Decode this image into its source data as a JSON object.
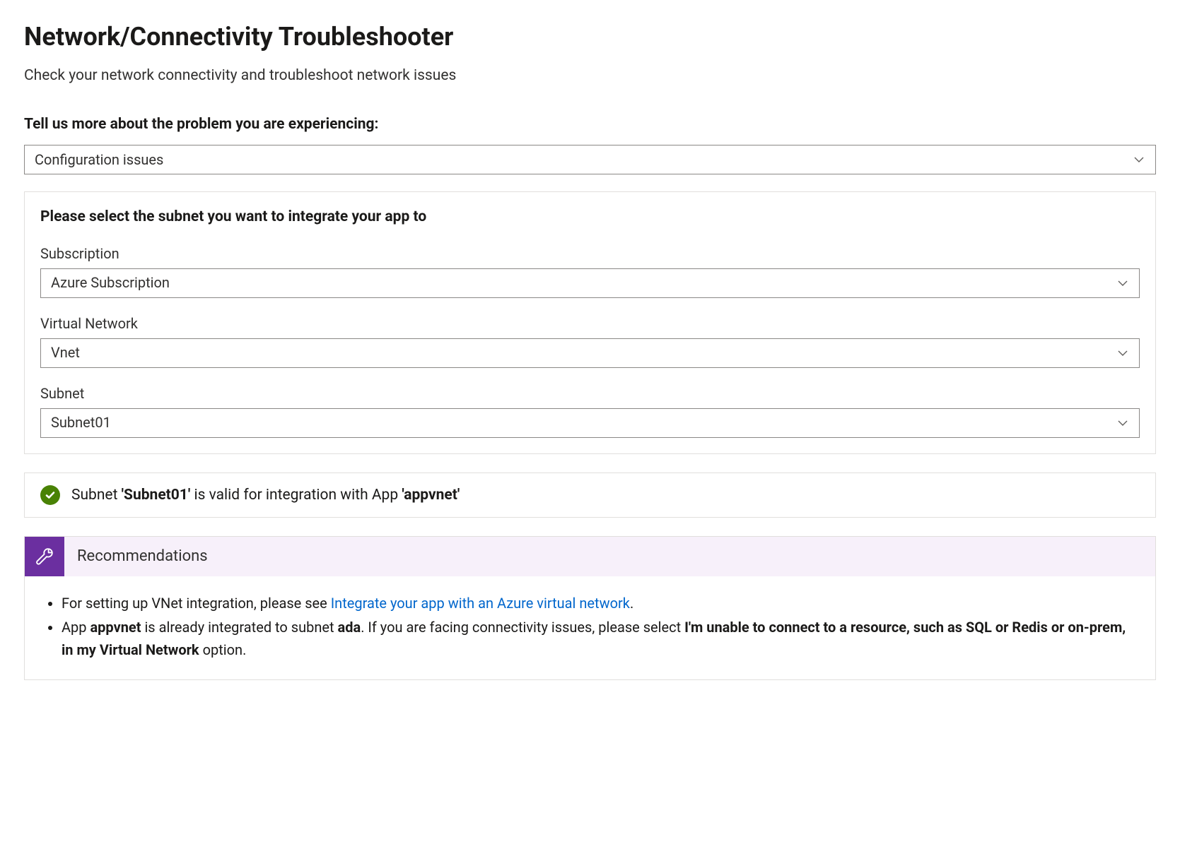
{
  "header": {
    "title": "Network/Connectivity Troubleshooter",
    "subtitle": "Check your network connectivity and troubleshoot network issues"
  },
  "problem": {
    "label": "Tell us more about the problem you are experiencing:",
    "selected": "Configuration issues"
  },
  "subnetPanel": {
    "heading": "Please select the subnet you want to integrate your app to",
    "fields": {
      "subscription": {
        "label": "Subscription",
        "value": "Azure Subscription"
      },
      "vnet": {
        "label": "Virtual Network",
        "value": "Vnet"
      },
      "subnet": {
        "label": "Subnet",
        "value": "Subnet01"
      }
    }
  },
  "status": {
    "prefix": "Subnet ",
    "subnetQuoted": "'Subnet01'",
    "middle": " is valid for integration with App ",
    "appQuoted": "'appvnet'"
  },
  "recommendations": {
    "title": "Recommendations",
    "item1": {
      "pre": "For setting up VNet integration, please see ",
      "linkText": "Integrate your app with an Azure virtual network",
      "post": "."
    },
    "item2": {
      "t1": "App ",
      "appName": "appvnet",
      "t2": " is already integrated to subnet ",
      "subnetName": "ada",
      "t3": ". If you are facing connectivity issues, please select ",
      "optionBold": "I'm unable to connect to a resource, such as SQL or Redis or on-prem, in my Virtual Network",
      "t4": " option."
    }
  }
}
